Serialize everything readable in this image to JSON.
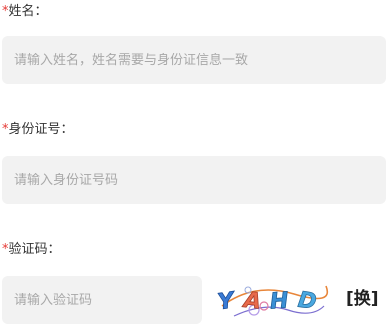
{
  "form": {
    "required_mark": "*",
    "name": {
      "label": "姓名：",
      "placeholder": "请输入姓名，姓名需要与身份证信息一致",
      "value": ""
    },
    "id_number": {
      "label": "身份证号：",
      "placeholder": "请输入身份证号码",
      "value": ""
    },
    "captcha": {
      "label": "验证码：",
      "placeholder": "请输入验证码",
      "value": "",
      "image_text": "YAHD",
      "refresh_label": "[换]"
    }
  },
  "colors": {
    "required": "#e53935",
    "field_bg": "#f2f2f2",
    "placeholder": "#a8a8a8"
  }
}
